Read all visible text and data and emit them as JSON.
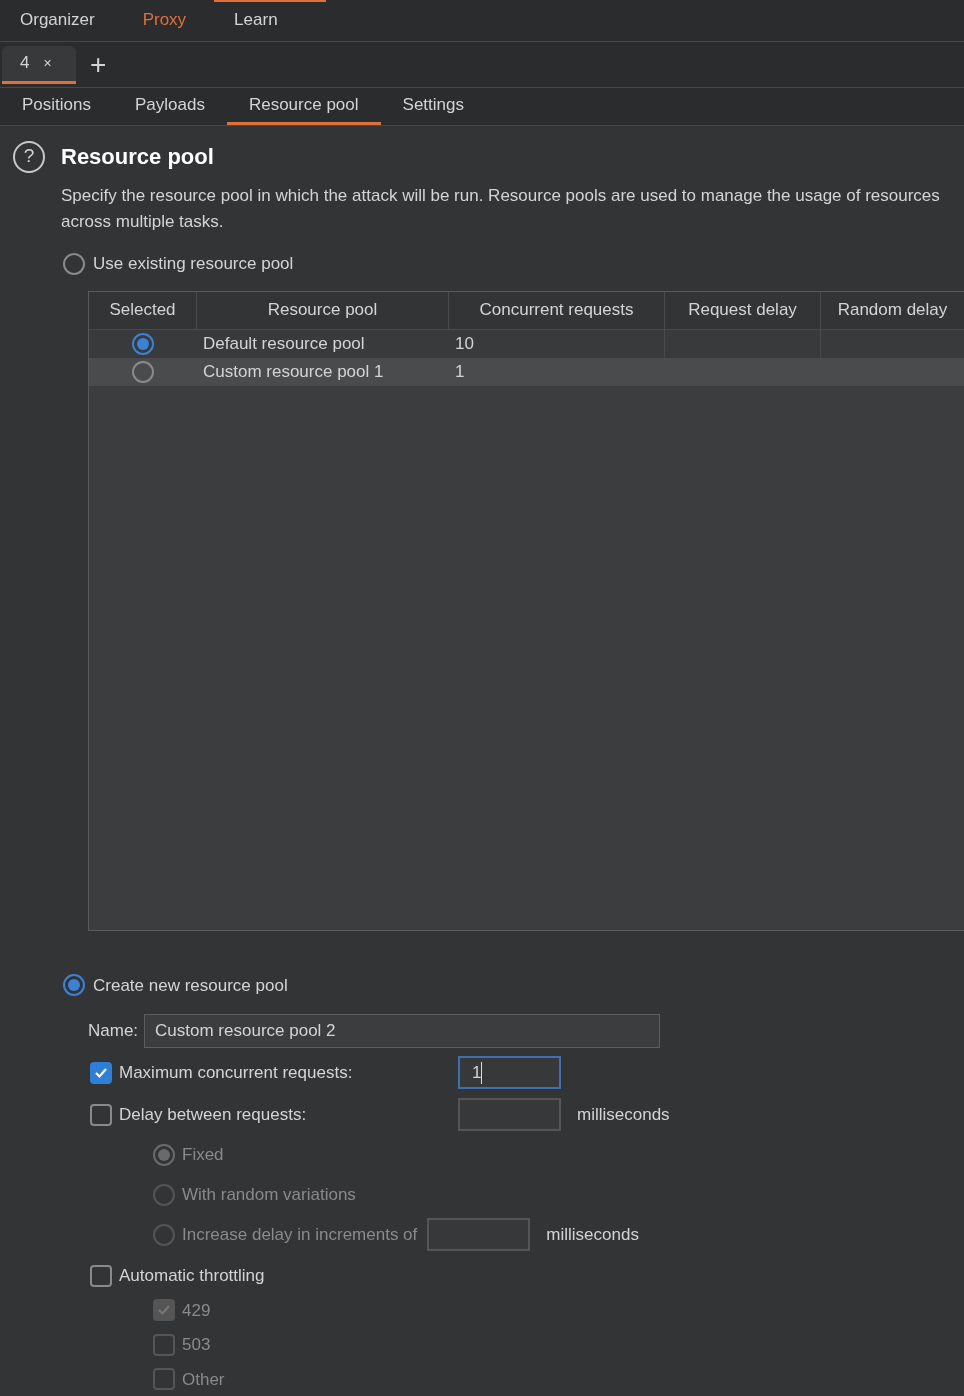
{
  "top_nav": [
    {
      "label": "Organizer",
      "highlighted": false
    },
    {
      "label": "Proxy",
      "highlighted": true
    },
    {
      "label": "Learn",
      "highlighted": false
    }
  ],
  "attack_tabs": [
    {
      "label": "4",
      "close": "×",
      "selected": true
    }
  ],
  "add_tab": "+",
  "sub_tabs": [
    {
      "label": "Positions",
      "selected": false
    },
    {
      "label": "Payloads",
      "selected": false
    },
    {
      "label": "Resource pool",
      "selected": true
    },
    {
      "label": "Settings",
      "selected": false
    }
  ],
  "section": {
    "help": "?",
    "title": "Resource pool",
    "description": "Specify the resource pool in which the attack will be run. Resource pools are used to manage the usage of resources across multiple tasks."
  },
  "use_existing": {
    "label": "Use existing resource pool",
    "selected": false
  },
  "table": {
    "columns": [
      "Selected",
      "Resource pool",
      "Concurrent requests",
      "Request delay",
      "Random delay"
    ],
    "rows": [
      {
        "selected": true,
        "highlighted": false,
        "cells": [
          "",
          "Default resource pool",
          "10",
          "",
          ""
        ]
      },
      {
        "selected": false,
        "highlighted": true,
        "cells": [
          "",
          "Custom resource pool 1",
          "1",
          "",
          ""
        ]
      }
    ]
  },
  "create_new": {
    "label": "Create new resource pool",
    "selected": true
  },
  "name_field": {
    "label": "Name:",
    "value": "Custom resource pool 2"
  },
  "max_concurrent": {
    "label": "Maximum concurrent requests:",
    "checked": true,
    "value": "1",
    "focused": true
  },
  "delay": {
    "label": "Delay between requests:",
    "checked": false,
    "unit": "milliseconds"
  },
  "delay_options": [
    {
      "label": "Fixed",
      "selected": true,
      "disabled": true,
      "kind": "plain"
    },
    {
      "label": "With random variations",
      "selected": false,
      "disabled": true,
      "kind": "plain"
    },
    {
      "label": "Increase delay in increments of",
      "selected": false,
      "disabled": true,
      "kind": "field",
      "unit": "milliseconds"
    }
  ],
  "throttling": {
    "label": "Automatic throttling",
    "checked": false
  },
  "throttle_codes": [
    {
      "label": "429",
      "checked": true,
      "disabled": true
    },
    {
      "label": "503",
      "checked": false,
      "disabled": true
    },
    {
      "label": "Other",
      "checked": false,
      "disabled": true
    }
  ]
}
